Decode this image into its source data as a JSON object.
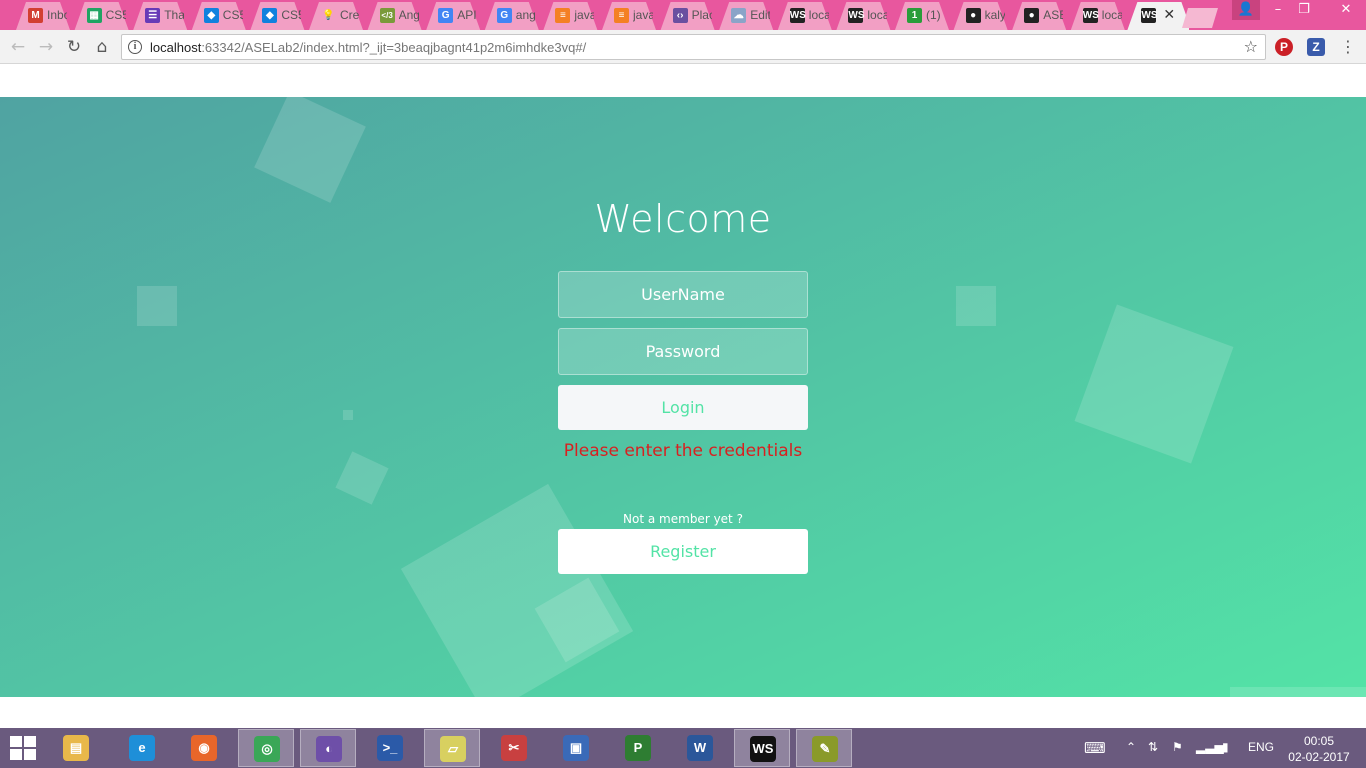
{
  "browser": {
    "tabs": [
      {
        "label": "Inbo",
        "icon": "gmail-icon",
        "glyph": "M",
        "color": "#d23f31"
      },
      {
        "label": "CS5",
        "icon": "sheets-icon",
        "glyph": "▦",
        "color": "#1fa463"
      },
      {
        "label": "Tha",
        "icon": "forms-icon",
        "glyph": "☰",
        "color": "#673ab7"
      },
      {
        "label": "CS5",
        "icon": "dropbox-icon",
        "glyph": "◆",
        "color": "#1081de"
      },
      {
        "label": "CS5",
        "icon": "dropbox-icon",
        "glyph": "◆",
        "color": "#1081de"
      },
      {
        "label": "Cre",
        "icon": "bulb-icon",
        "glyph": "💡",
        "color": "transparent"
      },
      {
        "label": "Ang",
        "icon": "angular-icon",
        "glyph": "</3",
        "color": "#7a9a3a"
      },
      {
        "label": "API",
        "icon": "google-icon",
        "glyph": "G",
        "color": "#4285f4"
      },
      {
        "label": "ang",
        "icon": "google-icon",
        "glyph": "G",
        "color": "#4285f4"
      },
      {
        "label": "java",
        "icon": "stackoverflow-icon",
        "glyph": "≡",
        "color": "#f48024"
      },
      {
        "label": "java",
        "icon": "stackoverflow-icon",
        "glyph": "≡",
        "color": "#f48024"
      },
      {
        "label": "Plac",
        "icon": "placeholder-icon",
        "glyph": "‹›",
        "color": "#6a4fa0"
      },
      {
        "label": "Edit",
        "icon": "cloud-icon",
        "glyph": "☁",
        "color": "#8aa4c8"
      },
      {
        "label": "loca",
        "icon": "webstorm-icon",
        "glyph": "WS",
        "color": "#222"
      },
      {
        "label": "loca",
        "icon": "webstorm-icon",
        "glyph": "WS",
        "color": "#222"
      },
      {
        "label": "(1) ",
        "icon": "notification-icon",
        "glyph": "1",
        "color": "#2a9d3a"
      },
      {
        "label": "kaly",
        "icon": "github-icon",
        "glyph": "●",
        "color": "#222"
      },
      {
        "label": "ASE",
        "icon": "github-icon",
        "glyph": "●",
        "color": "#222"
      },
      {
        "label": "loca",
        "icon": "webstorm-icon",
        "glyph": "WS",
        "color": "#222"
      },
      {
        "label": "",
        "icon": "webstorm-icon",
        "glyph": "WS",
        "color": "#222",
        "active": true
      }
    ],
    "active_tab_close": "✕",
    "window_controls": {
      "minimize": "–",
      "restore": "❐",
      "close": "✕",
      "user": "👤"
    },
    "url_host": "localhost",
    "url_rest": ":63342/ASELab2/index.html?_ijt=3beaqjbagnt41p2m6imhdke3vq#/",
    "extensions": [
      {
        "name": "pinterest-icon",
        "glyph": "P",
        "color": "#cb2027"
      },
      {
        "name": "z-extension-icon",
        "glyph": "Z",
        "color": "#3a5bab"
      }
    ]
  },
  "page": {
    "title": "Welcome",
    "username_placeholder": "UserName",
    "password_placeholder": "Password",
    "login_label": "Login",
    "error_message": "Please enter the credentials",
    "not_member_text": "Not a member yet ?",
    "register_label": "Register"
  },
  "taskbar": {
    "apps": [
      {
        "name": "file-explorer",
        "glyph": "▤",
        "color": "#e8b84a",
        "active": false
      },
      {
        "name": "internet-explorer",
        "glyph": "e",
        "color": "#1e8fd8",
        "active": false
      },
      {
        "name": "firefox",
        "glyph": "◉",
        "color": "#e8662a",
        "active": false
      },
      {
        "name": "chrome",
        "glyph": "◎",
        "color": "#3aa757",
        "active": true
      },
      {
        "name": "github-desktop",
        "glyph": "◐",
        "color": "#6e4fa8",
        "active": true
      },
      {
        "name": "powershell",
        "glyph": ">_",
        "color": "#2b5aa8",
        "active": false
      },
      {
        "name": "sticky-notes",
        "glyph": "▱",
        "color": "#d8d060",
        "active": true
      },
      {
        "name": "snipping-tool",
        "glyph": "✂",
        "color": "#c84040",
        "active": false
      },
      {
        "name": "remote-desktop",
        "glyph": "▣",
        "color": "#3a6ab8",
        "active": false
      },
      {
        "name": "project",
        "glyph": "P",
        "color": "#2e7d32",
        "active": false
      },
      {
        "name": "word",
        "glyph": "W",
        "color": "#2b579a",
        "active": false
      },
      {
        "name": "webstorm",
        "glyph": "WS",
        "color": "#111",
        "active": true
      },
      {
        "name": "task-editor",
        "glyph": "✎",
        "color": "#8a9a2a",
        "active": true
      }
    ],
    "language": "ENG",
    "time": "00:05",
    "date": "02-02-2017"
  }
}
